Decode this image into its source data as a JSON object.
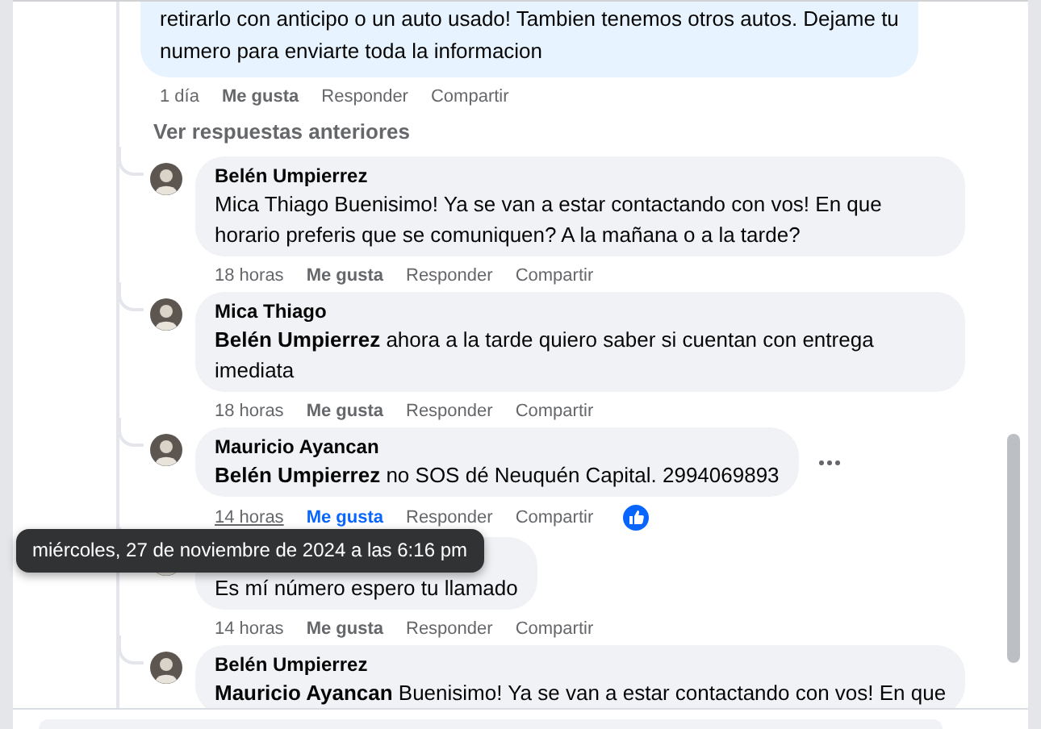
{
  "top_comment": {
    "lines": [
      "retirarlo con anticipo o un auto usado! Tambien tenemos otros autos. Dejame tu",
      "numero para enviarte toda la informacion"
    ],
    "time": "1 día",
    "like": "Me gusta",
    "reply": "Responder",
    "share": "Compartir",
    "liked": false
  },
  "view_previous": "Ver respuestas anteriores",
  "replies": [
    {
      "author": "Belén Umpierrez",
      "text": "Mica Thiago Buenisimo! Ya se van a estar contactando con vos! En que horario preferis que se comuniquen? A la mañana o a la tarde?",
      "time": "18 horas",
      "like": "Me gusta",
      "reply": "Responder",
      "share": "Compartir",
      "liked": false,
      "time_hovered": false,
      "more_menu": false
    },
    {
      "author": "Mica Thiago",
      "text": "**Belén Umpierrez** ahora a la tarde quiero saber si cuentan con entrega imediata",
      "time": "18 horas",
      "like": "Me gusta",
      "reply": "Responder",
      "share": "Compartir",
      "liked": false,
      "time_hovered": false,
      "more_menu": false
    },
    {
      "author": "Mauricio Ayancan",
      "text": "**Belén Umpierrez** no SOS dé Neuquén Capital. 2994069893",
      "time": "14 horas",
      "like": "Me gusta",
      "reply": "Responder",
      "share": "Compartir",
      "liked": true,
      "time_hovered": true,
      "more_menu": true
    },
    {
      "text": "Es mí número espero tu llamado",
      "time": "14 horas",
      "like": "Me gusta",
      "reply": "Responder",
      "share": "Compartir",
      "liked": false,
      "time_hovered": false,
      "more_menu": false
    },
    {
      "author": "Belén Umpierrez",
      "text": "**Mauricio Ayancan** Buenisimo! Ya se van a estar contactando con vos! En que",
      "liked": false,
      "time_hovered": false,
      "more_menu": false
    }
  ],
  "tooltip": "miércoles, 27 de noviembre de 2024 a las 6:16 pm"
}
